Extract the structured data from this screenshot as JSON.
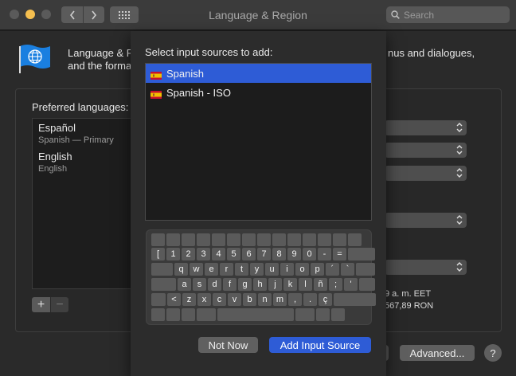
{
  "window": {
    "title": "Language & Region",
    "search_placeholder": "Search"
  },
  "pane": {
    "description_left_line1": "Language & R",
    "description_left_line2": "and the forma",
    "description_right": "nus and dialogues,",
    "preferred_label": "Preferred languages:",
    "languages": [
      {
        "name": "Español",
        "sub": "Spanish — Primary"
      },
      {
        "name": "English",
        "sub": "English"
      }
    ],
    "plus": "+",
    "minus": "−",
    "format_time": "9 a. m. EET",
    "format_number": "567,89 RON",
    "advanced_label": "Advanced...",
    "help_label": "?"
  },
  "sheet": {
    "title": "Select input sources to add:",
    "sources": [
      {
        "label": "Spanish",
        "selected": true
      },
      {
        "label": "Spanish - ISO",
        "selected": false
      }
    ],
    "keyboard_rows": [
      [
        "",
        "",
        "",
        "",
        "",
        "",
        "",
        "",
        "",
        "",
        "",
        "",
        "",
        ""
      ],
      [
        "[",
        "1",
        "2",
        "3",
        "4",
        "5",
        "6",
        "7",
        "8",
        "9",
        "0",
        "-",
        "=",
        ""
      ],
      [
        "",
        "q",
        "w",
        "e",
        "r",
        "t",
        "y",
        "u",
        "i",
        "o",
        "p",
        "´",
        "`",
        ""
      ],
      [
        "",
        "a",
        "s",
        "d",
        "f",
        "g",
        "h",
        "j",
        "k",
        "l",
        "ñ",
        ";",
        "'",
        ""
      ],
      [
        "",
        "<",
        "z",
        "x",
        "c",
        "v",
        "b",
        "n",
        "m",
        ",",
        ".",
        "ç",
        ""
      ],
      [
        "",
        "",
        "",
        "",
        "",
        "",
        "",
        ""
      ]
    ],
    "not_now_label": "Not Now",
    "add_label": "Add Input Source"
  },
  "colors": {
    "accent": "#2e5cd6",
    "flag_red": "#c8102e",
    "flag_yellow": "#f1bf00",
    "globe_blue": "#1a7fe0"
  },
  "icons": [
    "globe-flag-icon",
    "search-icon",
    "chevron-left-icon",
    "chevron-right-icon",
    "grid-icon",
    "updown-chevron-icon",
    "spanish-flag-icon"
  ]
}
